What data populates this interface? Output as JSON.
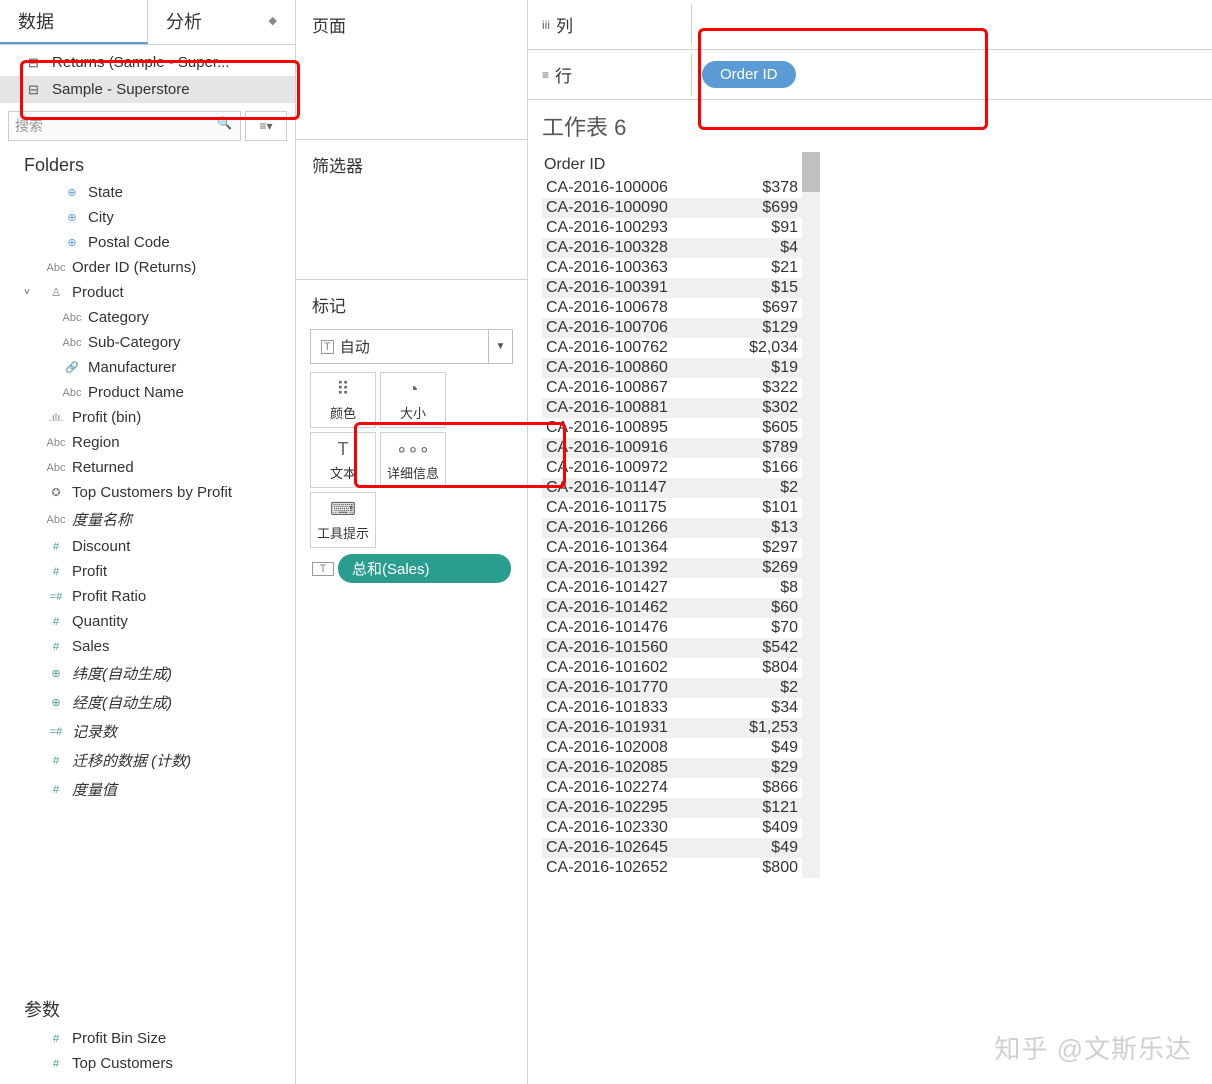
{
  "tabs": {
    "data": "数据",
    "analysis": "分析"
  },
  "datasources": [
    {
      "label": "Returns (Sample - Super...",
      "selected": false
    },
    {
      "label": "Sample - Superstore",
      "selected": true
    }
  ],
  "search_placeholder": "搜索",
  "folders_title": "Folders",
  "fields": [
    {
      "icon": "⊕",
      "iconClass": "geo",
      "label": "State",
      "indent": "indent"
    },
    {
      "icon": "⊕",
      "iconClass": "geo",
      "label": "City",
      "indent": "indent"
    },
    {
      "icon": "⊕",
      "iconClass": "geo",
      "label": "Postal Code",
      "indent": "indent"
    },
    {
      "icon": "Abc",
      "iconClass": "",
      "label": "Order ID (Returns)",
      "indent": "indent2"
    },
    {
      "icon": "♙",
      "iconClass": "",
      "label": "Product",
      "indent": "indent2",
      "expand": "˅"
    },
    {
      "icon": "Abc",
      "iconClass": "",
      "label": "Category",
      "indent": "indent"
    },
    {
      "icon": "Abc",
      "iconClass": "",
      "label": "Sub-Category",
      "indent": "indent"
    },
    {
      "icon": "🔗",
      "iconClass": "",
      "label": "Manufacturer",
      "indent": "indent"
    },
    {
      "icon": "Abc",
      "iconClass": "",
      "label": "Product Name",
      "indent": "indent"
    },
    {
      "icon": ".ılı.",
      "iconClass": "",
      "label": "Profit (bin)",
      "indent": "indent2"
    },
    {
      "icon": "Abc",
      "iconClass": "",
      "label": "Region",
      "indent": "indent2"
    },
    {
      "icon": "Abc",
      "iconClass": "",
      "label": "Returned",
      "indent": "indent2"
    },
    {
      "icon": "✪",
      "iconClass": "",
      "label": "Top Customers by Profit",
      "indent": "indent2"
    },
    {
      "icon": "Abc",
      "iconClass": "",
      "label": "度量名称",
      "indent": "indent2",
      "italic": true
    },
    {
      "icon": "#",
      "iconClass": "measure",
      "label": "Discount",
      "indent": "indent2"
    },
    {
      "icon": "#",
      "iconClass": "measure",
      "label": "Profit",
      "indent": "indent2"
    },
    {
      "icon": "=#",
      "iconClass": "measure",
      "label": "Profit Ratio",
      "indent": "indent2"
    },
    {
      "icon": "#",
      "iconClass": "measure",
      "label": "Quantity",
      "indent": "indent2"
    },
    {
      "icon": "#",
      "iconClass": "measure",
      "label": "Sales",
      "indent": "indent2"
    },
    {
      "icon": "⊕",
      "iconClass": "measure",
      "label": "纬度(自动生成)",
      "indent": "indent2",
      "italic": true
    },
    {
      "icon": "⊕",
      "iconClass": "measure",
      "label": "经度(自动生成)",
      "indent": "indent2",
      "italic": true
    },
    {
      "icon": "=#",
      "iconClass": "measure",
      "label": "记录数",
      "indent": "indent2",
      "italic": true
    },
    {
      "icon": "#",
      "iconClass": "measure",
      "label": "迁移的数据 (计数)",
      "indent": "indent2",
      "italic": true
    },
    {
      "icon": "#",
      "iconClass": "measure",
      "label": "度量值",
      "indent": "indent2",
      "italic": true
    }
  ],
  "params_title": "参数",
  "params": [
    {
      "icon": "#",
      "label": "Profit Bin Size"
    },
    {
      "icon": "#",
      "label": "Top Customers"
    }
  ],
  "pages_title": "页面",
  "filters_title": "筛选器",
  "marks_title": "标记",
  "marks_dropdown": "自动",
  "mark_buttons": [
    {
      "icon": "⠿",
      "label": "颜色"
    },
    {
      "icon": "◔",
      "label": "大小"
    },
    {
      "icon": "T",
      "label": "文本"
    },
    {
      "icon": "∘∘∘",
      "label": "详细信息"
    },
    {
      "icon": "⌨",
      "label": "工具提示"
    }
  ],
  "mark_pill": "总和(Sales)",
  "columns_label": "列",
  "rows_label": "行",
  "row_pill": "Order ID",
  "worksheet_title": "工作表 6",
  "table_header": "Order ID",
  "rows": [
    {
      "id": "CA-2016-100006",
      "v": "$378"
    },
    {
      "id": "CA-2016-100090",
      "v": "$699"
    },
    {
      "id": "CA-2016-100293",
      "v": "$91"
    },
    {
      "id": "CA-2016-100328",
      "v": "$4"
    },
    {
      "id": "CA-2016-100363",
      "v": "$21"
    },
    {
      "id": "CA-2016-100391",
      "v": "$15"
    },
    {
      "id": "CA-2016-100678",
      "v": "$697"
    },
    {
      "id": "CA-2016-100706",
      "v": "$129"
    },
    {
      "id": "CA-2016-100762",
      "v": "$2,034"
    },
    {
      "id": "CA-2016-100860",
      "v": "$19"
    },
    {
      "id": "CA-2016-100867",
      "v": "$322"
    },
    {
      "id": "CA-2016-100881",
      "v": "$302"
    },
    {
      "id": "CA-2016-100895",
      "v": "$605"
    },
    {
      "id": "CA-2016-100916",
      "v": "$789"
    },
    {
      "id": "CA-2016-100972",
      "v": "$166"
    },
    {
      "id": "CA-2016-101147",
      "v": "$2"
    },
    {
      "id": "CA-2016-101175",
      "v": "$101"
    },
    {
      "id": "CA-2016-101266",
      "v": "$13"
    },
    {
      "id": "CA-2016-101364",
      "v": "$297"
    },
    {
      "id": "CA-2016-101392",
      "v": "$269"
    },
    {
      "id": "CA-2016-101427",
      "v": "$8"
    },
    {
      "id": "CA-2016-101462",
      "v": "$60"
    },
    {
      "id": "CA-2016-101476",
      "v": "$70"
    },
    {
      "id": "CA-2016-101560",
      "v": "$542"
    },
    {
      "id": "CA-2016-101602",
      "v": "$804"
    },
    {
      "id": "CA-2016-101770",
      "v": "$2"
    },
    {
      "id": "CA-2016-101833",
      "v": "$34"
    },
    {
      "id": "CA-2016-101931",
      "v": "$1,253"
    },
    {
      "id": "CA-2016-102008",
      "v": "$49"
    },
    {
      "id": "CA-2016-102085",
      "v": "$29"
    },
    {
      "id": "CA-2016-102274",
      "v": "$866"
    },
    {
      "id": "CA-2016-102295",
      "v": "$121"
    },
    {
      "id": "CA-2016-102330",
      "v": "$409"
    },
    {
      "id": "CA-2016-102645",
      "v": "$49"
    },
    {
      "id": "CA-2016-102652",
      "v": "$800"
    }
  ],
  "watermark": "知乎 @文斯乐达"
}
